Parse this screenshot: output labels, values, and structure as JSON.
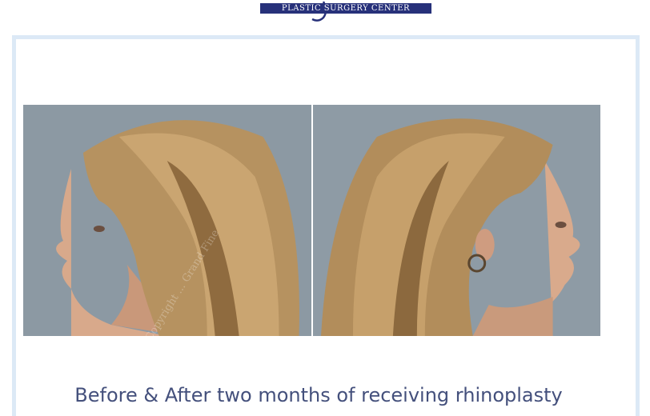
{
  "header": {
    "logo_text": "PLASTIC SURGERY CENTER"
  },
  "gallery": {
    "before_label": "before-photo",
    "after_label": "after-photo",
    "watermark": "Copyright ... Grand Fine"
  },
  "caption": {
    "text": "Before & After  two months of receiving rhinoplasty"
  },
  "colors": {
    "brand_navy": "#27317a",
    "card_border": "#dce9f6",
    "caption_text": "#44507c",
    "photo_background": "#8d9aa4",
    "hair": "#b8925c",
    "skin": "#d9a889"
  }
}
